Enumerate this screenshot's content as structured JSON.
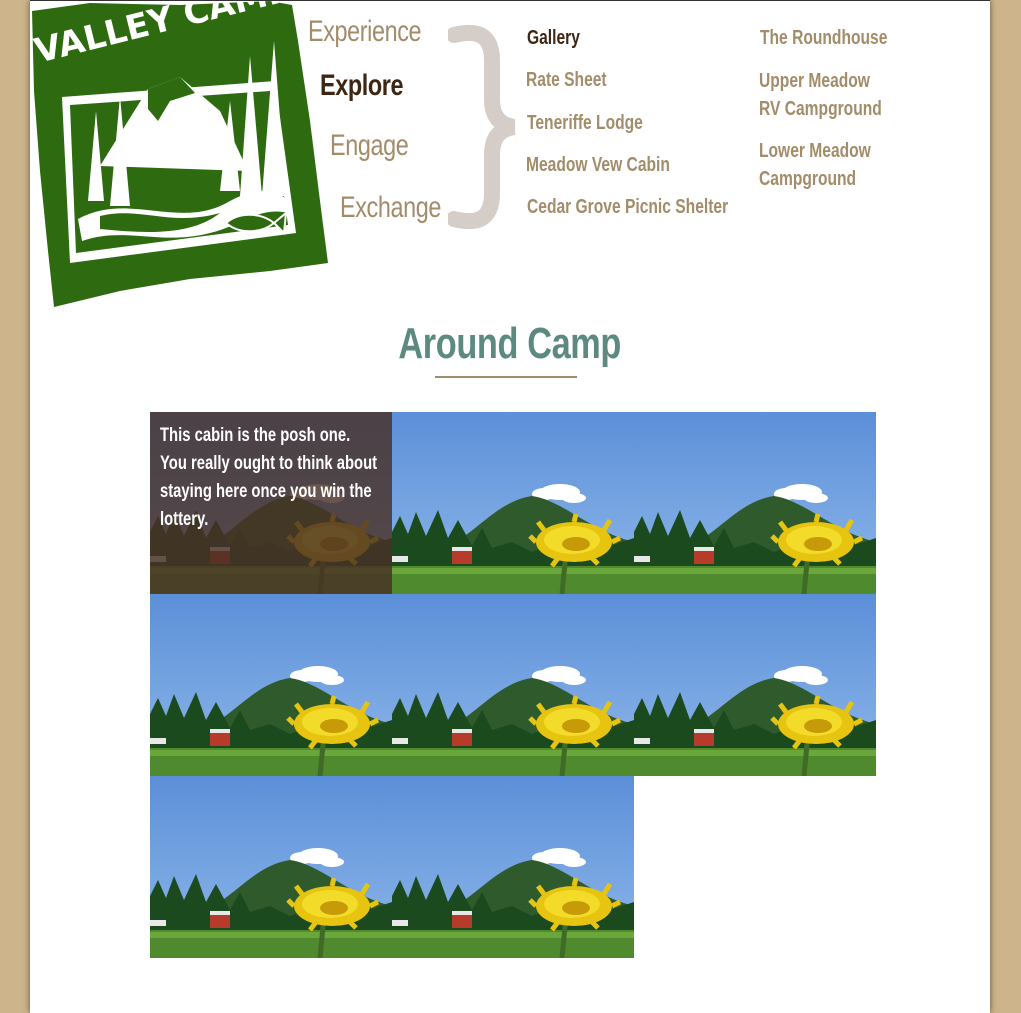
{
  "logo": {
    "text": "VALLEY CAMP",
    "colors": {
      "green": "#2e6b10",
      "white": "#ffffff"
    }
  },
  "primary_nav": [
    {
      "label": "Experience",
      "active": false
    },
    {
      "label": "Explore",
      "active": true
    },
    {
      "label": "Engage",
      "active": false
    },
    {
      "label": "Exchange",
      "active": false
    }
  ],
  "sub_nav": {
    "column1": [
      {
        "label": "Gallery",
        "active": true
      },
      {
        "label": "Rate Sheet"
      },
      {
        "label": "Teneriffe Lodge"
      },
      {
        "label": "Meadow Vew Cabin"
      },
      {
        "label": "Cedar Grove Picnic Shelter"
      }
    ],
    "column2": [
      {
        "line1": "The Roundhouse",
        "line2": ""
      },
      {
        "line1": "Upper Meadow",
        "line2": "RV Campground"
      },
      {
        "line1": "Lower Meadow",
        "line2": "Campground"
      }
    ]
  },
  "page_title": "Around Camp",
  "gallery": {
    "caption": "This cabin is the posh one. You really ought to think about staying here once you win the lottery.",
    "tile_count": 8
  },
  "colors": {
    "background": "#cdb48a",
    "nav_text": "#a28c6a",
    "nav_active": "#3d2613",
    "heading": "#5c8a80",
    "brace": "#d5cdc7"
  }
}
